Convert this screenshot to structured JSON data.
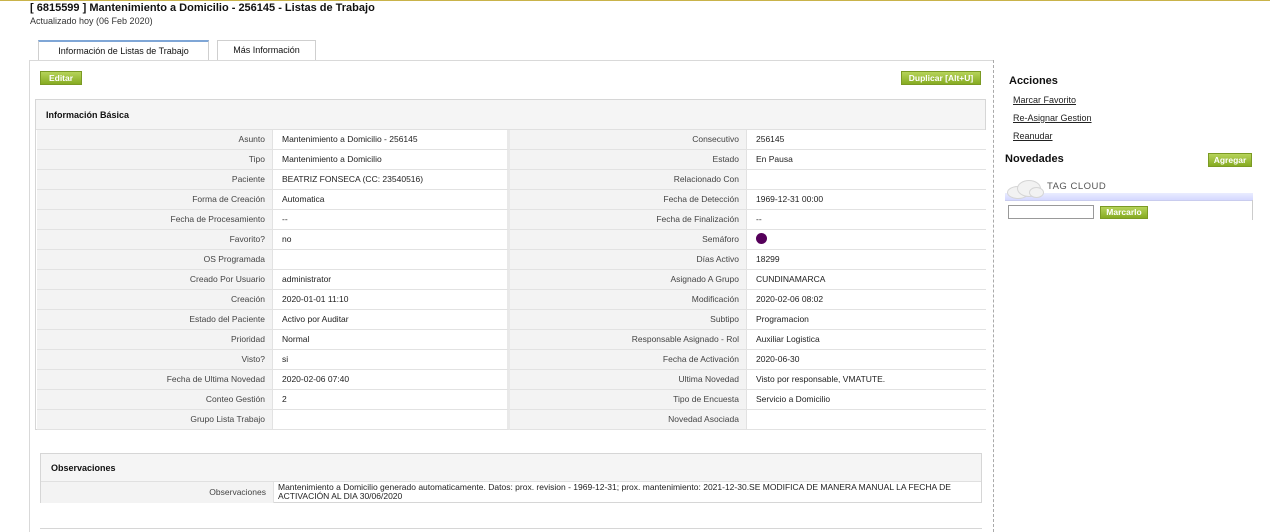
{
  "header": {
    "title": "[ 6815599 ] Mantenimiento a Domicilio - 256145 - Listas de Trabajo",
    "subtitle": "Actualizado hoy (06 Feb 2020)"
  },
  "tabs": [
    {
      "label": "Información de Listas de Trabajo",
      "active": true
    },
    {
      "label": "Más Información",
      "active": false
    }
  ],
  "toolbar": {
    "edit_label": "Editar",
    "duplicate_label": "Duplicar [Alt+U]"
  },
  "basic_info": {
    "title": "Información Básica",
    "rows": [
      {
        "l1": "Asunto",
        "v1": "Mantenimiento a Domicilio - 256145",
        "l2": "Consecutivo",
        "v2": "256145"
      },
      {
        "l1": "Tipo",
        "v1": "Mantenimiento a Domicilio",
        "l2": "Estado",
        "v2": "En Pausa"
      },
      {
        "l1": "Paciente",
        "v1": "BEATRIZ FONSECA (CC: 23540516)",
        "l2": "Relacionado Con",
        "v2": ""
      },
      {
        "l1": "Forma de Creación",
        "v1": "Automatica",
        "l2": "Fecha de Detección",
        "v2": "1969-12-31 00:00"
      },
      {
        "l1": "Fecha de Procesamiento",
        "v1": "--",
        "l2": "Fecha de Finalización",
        "v2": "--"
      },
      {
        "l1": "Favorito?",
        "v1": " no",
        "l2": "Semáforo",
        "v2": ""
      },
      {
        "l1": "OS Programada",
        "v1": "",
        "l2": "Días Activo",
        "v2": "18299"
      },
      {
        "l1": "Creado Por Usuario",
        "v1": "administrator",
        "l2": "Asignado A Grupo",
        "v2": "CUNDINAMARCA"
      },
      {
        "l1": "Creación",
        "v1": "2020-01-01 11:10",
        "l2": "Modificación",
        "v2": "2020-02-06 08:02"
      },
      {
        "l1": "Estado del Paciente",
        "v1": "Activo por Auditar",
        "l2": "Subtipo",
        "v2": "Programacion"
      },
      {
        "l1": "Prioridad",
        "v1": "Normal",
        "l2": "Responsable Asignado - Rol",
        "v2": "Auxiliar Logistica"
      },
      {
        "l1": "Visto?",
        "v1": " si",
        "l2": "Fecha de Activación",
        "v2": " 2020-06-30"
      },
      {
        "l1": "Fecha de Ultima Novedad",
        "v1": "2020-02-06 07:40",
        "l2": "Ultima Novedad",
        "v2": " Visto por responsable, VMATUTE."
      },
      {
        "l1": "Conteo Gestión",
        "v1": "2",
        "l2": "Tipo de Encuesta",
        "v2": "Servicio a Domicilio"
      },
      {
        "l1": "Grupo Lista Trabajo",
        "v1": "",
        "l2": "Novedad Asociada",
        "v2": ""
      }
    ],
    "semaforo_color": "#55005a"
  },
  "observations": {
    "title": "Observaciones",
    "label": "Observaciones",
    "value": "Mantenimiento a Domicilio generado automaticamente. Datos: prox. revision - 1969-12-31; prox. mantenimiento: 2021-12-30.SE MODIFICA DE MANERA MANUAL LA FECHA DE ACTIVACIÓN AL DIA 30/06/2020"
  },
  "sidebar": {
    "acciones_title": "Acciones",
    "actions": [
      "Marcar Favorito",
      "Re-Asignar Gestion",
      "Reanudar"
    ],
    "novedades_title": "Novedades",
    "add_label": "Agregar",
    "tag_cloud_label": "TAG CLOUD",
    "tag_input_value": "",
    "mark_label": "Marcarlo"
  },
  "colors": {
    "button_green": "#86ab22",
    "header_rule": "#c9b34a"
  }
}
